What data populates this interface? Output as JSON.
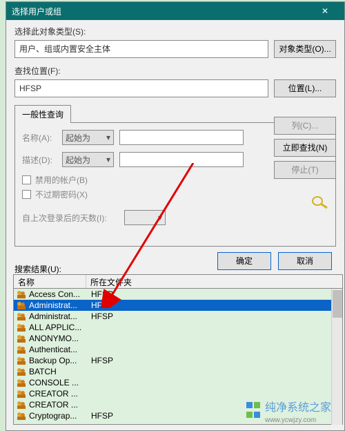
{
  "title": "选择用户或组",
  "object_type": {
    "label": "选择此对象类型(S):",
    "value": "用户、组或内置安全主体",
    "btn": "对象类型(O)..."
  },
  "location": {
    "label": "查找位置(F):",
    "value": "HFSP",
    "btn": "位置(L)..."
  },
  "tab": "一般性查询",
  "query": {
    "name_lbl": "名称(A):",
    "desc_lbl": "描述(D):",
    "dd": "起始为",
    "disabled": "禁用的帐户(B)",
    "nonexpire": "不过期密码(X)",
    "days": "自上次登录后的天数(I):"
  },
  "buttons": {
    "columns": "列(C)...",
    "find": "立即查找(N)",
    "stop": "停止(T)",
    "ok": "确定",
    "cancel": "取消"
  },
  "results_lbl": "搜索结果(U):",
  "headers": {
    "name": "名称",
    "folder": "所在文件夹"
  },
  "rows": [
    {
      "n": "Access Con...",
      "f": "HFSP"
    },
    {
      "n": "Administrat...",
      "f": "HFSP",
      "sel": true
    },
    {
      "n": "Administrat...",
      "f": "HFSP"
    },
    {
      "n": "ALL APPLIC...",
      "f": ""
    },
    {
      "n": "ANONYMO...",
      "f": ""
    },
    {
      "n": "Authenticat...",
      "f": ""
    },
    {
      "n": "Backup Op...",
      "f": "HFSP"
    },
    {
      "n": "BATCH",
      "f": ""
    },
    {
      "n": "CONSOLE ...",
      "f": ""
    },
    {
      "n": "CREATOR ...",
      "f": ""
    },
    {
      "n": "CREATOR ...",
      "f": ""
    },
    {
      "n": "Cryptograp...",
      "f": "HFSP"
    }
  ],
  "wm": {
    "text": "纯净系统之家",
    "url": "www.ycwjzy.com"
  }
}
